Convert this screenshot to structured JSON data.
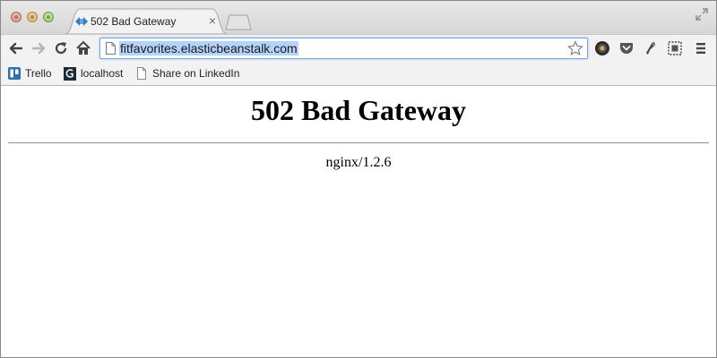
{
  "browser": {
    "tab": {
      "title": "502 Bad Gateway",
      "close_glyph": "×",
      "favicon": "elastic-beanstalk-favicon-icon"
    },
    "url": "fitfavorites.elasticbeanstalk.com",
    "icons": {
      "back": "back-arrow-icon",
      "forward": "forward-arrow-icon",
      "reload": "reload-icon",
      "home": "home-icon",
      "star": "bookmark-star-icon",
      "extensions": [
        "dark-circle-extension-icon",
        "pocket-icon",
        "tool-extension-icon",
        "screenshot-extension-icon"
      ],
      "menu": "hamburger-menu-icon"
    },
    "bookmarks": [
      {
        "label": "Trello",
        "icon": "trello-icon"
      },
      {
        "label": "localhost",
        "icon": "g-icon"
      },
      {
        "label": "Share on LinkedIn",
        "icon": "page-icon"
      }
    ],
    "colors": {
      "omnibox_border": "#7aa7e0",
      "url_selection": "#b3d3fb"
    }
  },
  "page": {
    "heading": "502 Bad Gateway",
    "server": "nginx/1.2.6"
  }
}
